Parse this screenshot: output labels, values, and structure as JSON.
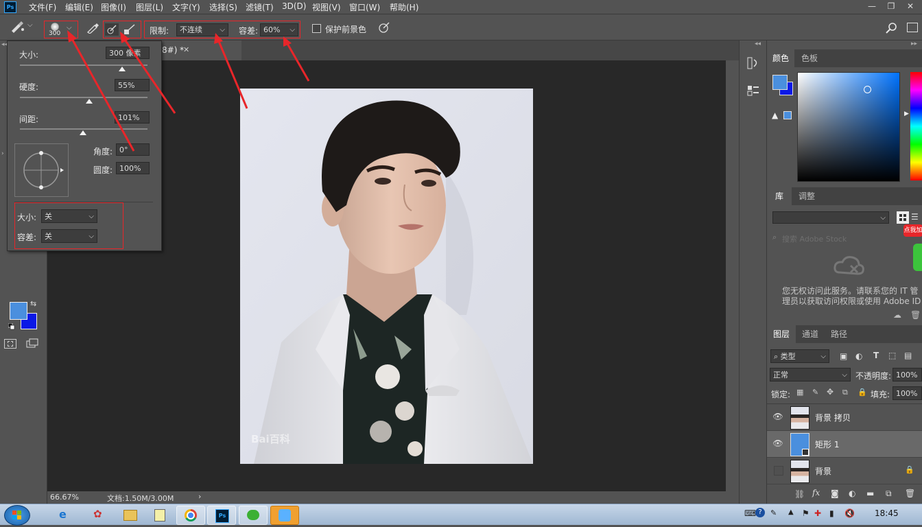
{
  "app": {
    "logo": "Ps"
  },
  "menu": [
    "文件(F)",
    "编辑(E)",
    "图像(I)",
    "图层(L)",
    "文字(Y)",
    "选择(S)",
    "滤镜(T)",
    "3D(D)",
    "视图(V)",
    "窗口(W)",
    "帮助(H)"
  ],
  "options": {
    "brush_size": "300",
    "limit_label": "限制:",
    "limit_value": "不连续",
    "tolerance_label": "容差:",
    "tolerance_value": "60%",
    "protect_fg_label": "保护前景色"
  },
  "brush_popup": {
    "size_label": "大小:",
    "size_value": "300 像素",
    "hardness_label": "硬度:",
    "hardness_value": "55%",
    "spacing_label": "间距:",
    "spacing_value": "101%",
    "angle_label": "角度:",
    "angle_value": "0°",
    "roundness_label": "圆度:",
    "roundness_value": "100%",
    "pen_size_label": "大小:",
    "pen_size_value": "关",
    "pen_tolerance_label": "容差:",
    "pen_tolerance_value": "关"
  },
  "document": {
    "tab_title": "8#) *",
    "zoom": "66.67%",
    "doc_size": "文档:1.50M/3.00M",
    "watermark": "Bai百科"
  },
  "colors": {
    "foreground": "#4a8fde",
    "background": "#0a18e6",
    "accent_red": "#e8262a"
  },
  "color_panel": {
    "tabs": [
      "颜色",
      "色板"
    ]
  },
  "library_panel": {
    "tabs": [
      "库",
      "调整"
    ],
    "search_placeholder": "搜索 Adobe Stock",
    "message_line1": "您无权访问此服务。请联系您的 IT 管",
    "message_line2": "理员以获取访问权限或使用 Adobe ID",
    "promo_badge": "点我加"
  },
  "layers_panel": {
    "tabs": [
      "图层",
      "通道",
      "路径"
    ],
    "filter_kind": "类型",
    "blend_mode": "正常",
    "opacity_label": "不透明度:",
    "opacity_value": "100%",
    "lock_label": "锁定:",
    "fill_label": "填充:",
    "fill_value": "100%",
    "layers": [
      {
        "name": "背景 拷贝",
        "visible": true
      },
      {
        "name": "矩形 1",
        "visible": true
      },
      {
        "name": "背景",
        "visible": false
      }
    ]
  },
  "taskbar": {
    "clock": "18:45"
  }
}
